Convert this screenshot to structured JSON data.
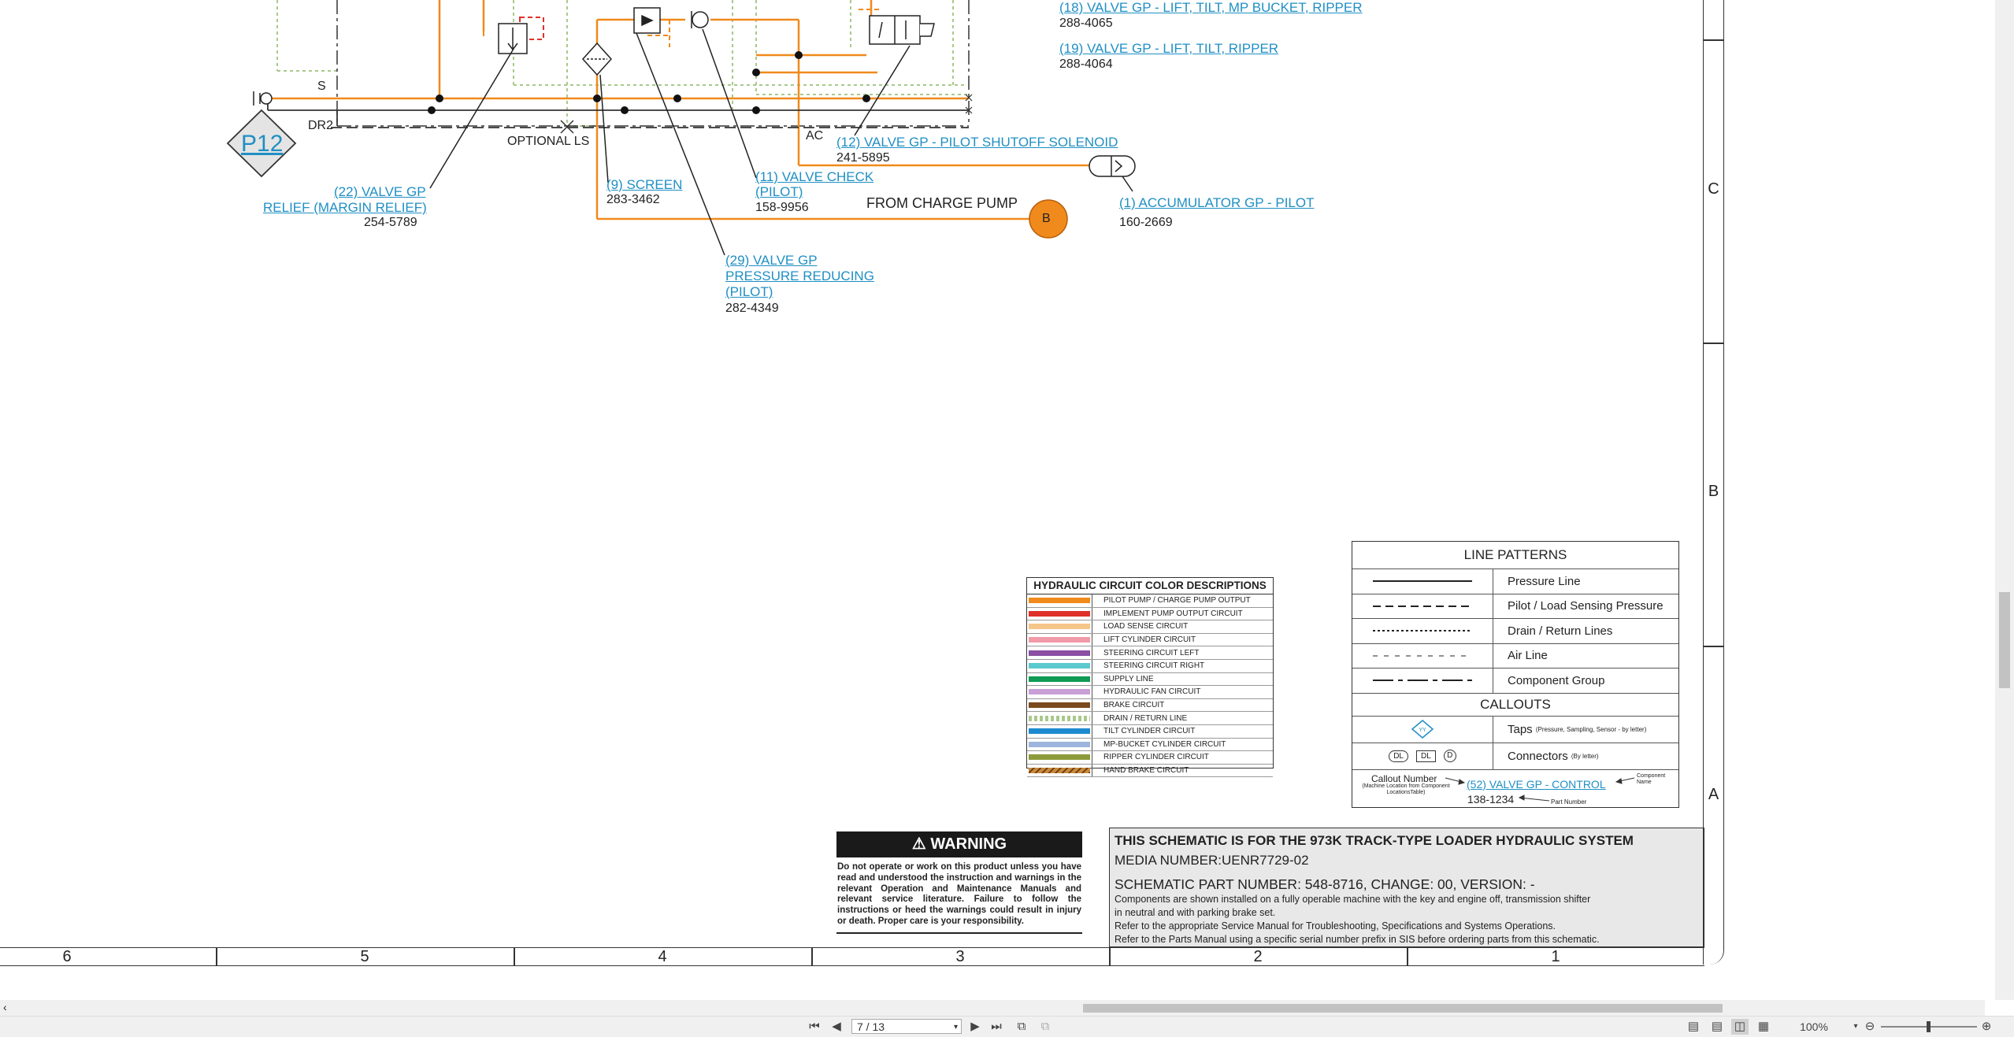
{
  "schematic": {
    "top_labels": {
      "valve_18": "(18) VALVE GP - LIFT, TILT, MP BUCKET, RIPPER",
      "valve_18_part": "288-4065",
      "valve_19": "(19) VALVE GP - LIFT, TILT, RIPPER",
      "valve_19_part": "288-4064"
    },
    "tap_p12": "P12",
    "line_labels": {
      "s": "S",
      "dr2": "DR2",
      "optional_ls": "OPTIONAL LS",
      "ac": "AC",
      "from_charge_pump": "FROM CHARGE PUMP",
      "connector_b": "B"
    },
    "callouts": {
      "valve_22_line1": "(22) VALVE GP",
      "valve_22_line2": "RELIEF (MARGIN RELIEF)",
      "valve_22_part": "254-5789",
      "screen_9": "(9) SCREEN",
      "screen_9_part": "283-3462",
      "check_11_line1": "(11) VALVE CHECK",
      "check_11_line2": "(PILOT)",
      "check_11_part": "158-9956",
      "valve_29_line1": "(29) VALVE GP",
      "valve_29_line2": "PRESSURE REDUCING",
      "valve_29_line3": "(PILOT)",
      "valve_29_part": "282-4349",
      "valve_12": "(12) VALVE GP -  PILOT SHUTOFF SOLENOID",
      "valve_12_part": "241-5895",
      "accumulator_1": "(1) ACCUMULATOR GP - PILOT",
      "accumulator_1_part": "160-2669"
    }
  },
  "color_legend": {
    "title": "HYDRAULIC CIRCUIT COLOR DESCRIPTIONS",
    "items": [
      {
        "name": "PILOT PUMP / CHARGE PUMP OUTPUT",
        "color": "#f08a1c",
        "pattern": "solid"
      },
      {
        "name": "IMPLEMENT PUMP OUTPUT CIRCUIT",
        "color": "#e0302a",
        "pattern": "solid"
      },
      {
        "name": "LOAD SENSE CIRCUIT",
        "color": "#f5c58a",
        "pattern": "solid"
      },
      {
        "name": "LIFT CYLINDER CIRCUIT",
        "color": "#f29aa8",
        "pattern": "solid"
      },
      {
        "name": "STEERING CIRCUIT LEFT",
        "color": "#8b4fa3",
        "pattern": "solid"
      },
      {
        "name": "STEERING CIRCUIT RIGHT",
        "color": "#5cc9cf",
        "pattern": "solid"
      },
      {
        "name": "SUPPLY LINE",
        "color": "#0f9a55",
        "pattern": "solid"
      },
      {
        "name": "HYDRAULIC FAN CIRCUIT",
        "color": "#c9a0d6",
        "pattern": "solid"
      },
      {
        "name": "BRAKE CIRCUIT",
        "color": "#7a4a1e",
        "pattern": "solid"
      },
      {
        "name": "DRAIN / RETURN LINE",
        "color": "#a9c98a",
        "pattern": "dotted"
      },
      {
        "name": "TILT CYLINDER CIRCUIT",
        "color": "#1d8ad0",
        "pattern": "solid"
      },
      {
        "name": "MP-BUCKET CYLINDER CIRCUIT",
        "color": "#9db5dc",
        "pattern": "solid"
      },
      {
        "name": "RIPPER CYLINDER CIRCUIT",
        "color": "#8d9a3c",
        "pattern": "solid"
      },
      {
        "name": "HAND BRAKE CIRCUIT",
        "color": "#c98a3a",
        "pattern": "hatched"
      }
    ]
  },
  "line_patterns": {
    "title": "LINE PATTERNS",
    "items": [
      {
        "name": "Pressure Line",
        "style": "solid"
      },
      {
        "name": "Pilot / Load Sensing Pressure",
        "style": "long-dash"
      },
      {
        "name": "Drain / Return Lines",
        "style": "dotted"
      },
      {
        "name": "Air Line",
        "style": "short-dash"
      },
      {
        "name": "Component Group",
        "style": "dash-dot"
      }
    ],
    "callouts_title": "CALLOUTS",
    "taps": "Taps",
    "taps_note": "(Pressure, Sampling, Sensor - by letter)",
    "tap_symbol": "YY",
    "connectors": "Connectors",
    "connectors_note": "(By letter)",
    "connector_symbols": [
      "DL",
      "DL",
      "D"
    ],
    "callout_number": "Callout Number",
    "callout_number_note": "(Machine Location from Component LocationsTable)",
    "callout_example": "(52) VALVE GP - CONTROL",
    "callout_example_part": "138-1234",
    "component_name": "Component Name",
    "part_number": "Part Number"
  },
  "warning": {
    "title": "WARNING",
    "text": "Do not operate or work on this product unless you have read and understood the instruction and warnings in the relevant Operation and Maintenance Manuals and relevant service literature. Failure to follow the instructions or heed the warnings could result in injury or death. Proper care is your responsibility."
  },
  "title_block": {
    "line1": "THIS SCHEMATIC IS FOR THE 973K TRACK-TYPE LOADER HYDRAULIC SYSTEM",
    "line2": "MEDIA NUMBER:UENR7729-02",
    "line3": "SCHEMATIC PART NUMBER: 548-8716, CHANGE: 00, VERSION: -",
    "line4": "Components are shown installed on a fully operable machine with the key and engine off, transmission shifter",
    "line5": "in neutral and with parking brake set.",
    "line6": "Refer to the appropriate Service Manual for Troubleshooting, Specifications and Systems Operations.",
    "line7": "Refer to the Parts Manual using a specific serial number prefix in SIS before ordering parts from this schematic."
  },
  "grid": {
    "columns": [
      "6",
      "5",
      "4",
      "3",
      "2",
      "1"
    ],
    "rows": [
      "C",
      "B",
      "A"
    ]
  },
  "viewer": {
    "page_indicator": "7 / 13",
    "zoom": "100%"
  },
  "colors": {
    "link": "#1f8fc4",
    "pilot_line": "#f08a1c",
    "implement": "#e0302a",
    "drain": "#a9c98a"
  }
}
